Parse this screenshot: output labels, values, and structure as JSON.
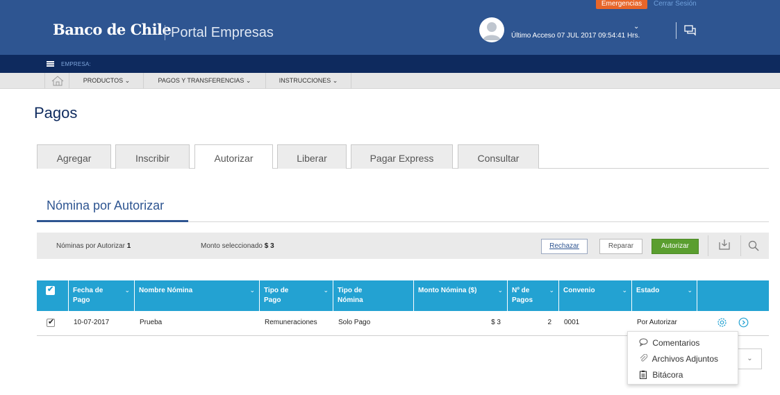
{
  "header": {
    "logo": "Banco de Chile",
    "portal": "Portal Empresas",
    "emergency_label": "Emergencias",
    "logout_label": "Cerrar Sesión",
    "last_access": "Último Acceso 07 JUL 2017 09:54:41 Hrs.",
    "brand_color": "#2e5591",
    "emergency_color": "#e8662a"
  },
  "empresa_bar": {
    "label": "EMPRESA:"
  },
  "nav": {
    "items": [
      "PRODUCTOS",
      "PAGOS Y TRANSFERENCIAS",
      "INSTRUCCIONES"
    ]
  },
  "page": {
    "title": "Pagos",
    "tabs": [
      "Agregar",
      "Inscribir",
      "Autorizar",
      "Liberar",
      "Pagar Express",
      "Consultar"
    ],
    "active_tab": "Autorizar",
    "subtitle": "Nómina por Autorizar"
  },
  "toolbar": {
    "count_label": "Nóminas por Autorizar",
    "count_value": "1",
    "amount_label": "Monto seleccionado",
    "amount_value": "$ 3",
    "reject_label": "Rechazar",
    "repair_label": "Reparar",
    "authorize_label": "Autorizar",
    "authorize_color": "#5a9e2f"
  },
  "table": {
    "header_color": "#23a2d2",
    "columns": [
      "Fecha de Pago",
      "Nombre Nómina",
      "Tipo de Pago",
      "Tipo de Nómina",
      "Monto Nómina ($)",
      "Nº de Pagos",
      "Convenio",
      "Estado"
    ],
    "rows": [
      {
        "fecha": "10-07-2017",
        "nombre": "Prueba",
        "tipo_pago": "Remuneraciones",
        "tipo_nomina": "Solo Pago",
        "monto": "$ 3",
        "n_pagos": "2",
        "convenio": "0001",
        "estado": "Por Autorizar"
      }
    ]
  },
  "menu": {
    "items": [
      "Comentarios",
      "Archivos Adjuntos",
      "Bitácora"
    ]
  }
}
